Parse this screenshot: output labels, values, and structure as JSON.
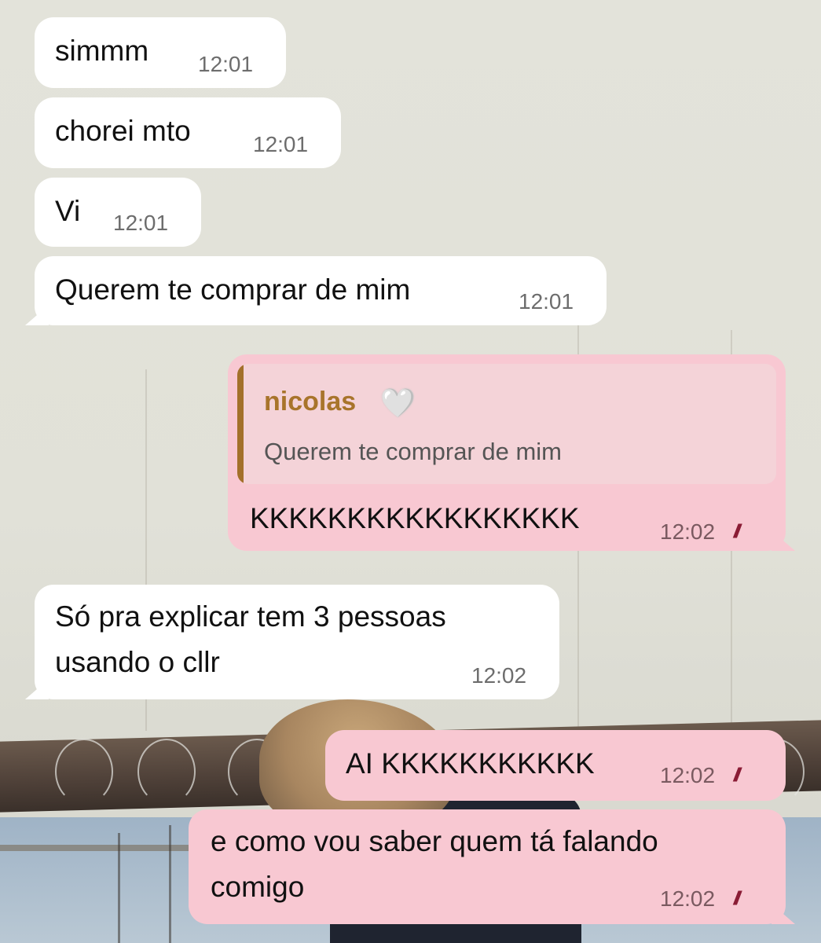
{
  "messages": [
    {
      "text": "simmm",
      "time": "12:01"
    },
    {
      "text": "chorei mto",
      "time": "12:01"
    },
    {
      "text": "Vi",
      "time": "12:01"
    },
    {
      "text": "Querem te comprar de mim",
      "time": "12:01"
    },
    {
      "text": "KKKKKKKKKKKKKKKKK",
      "time": "12:02",
      "reply_to": {
        "sender": "nicolas",
        "emoji": "🤍",
        "text": "Querem te comprar de mim"
      }
    },
    {
      "lines": [
        "Só pra explicar tem 3 pessoas",
        "usando o cllr"
      ],
      "time": "12:02"
    },
    {
      "text": "AI KKKKKKKKKKK",
      "time": "12:02"
    },
    {
      "lines": [
        "e como vou saber quem tá falando",
        "comigo"
      ],
      "time": "12:02"
    }
  ],
  "colors": {
    "incoming": "#ffffff",
    "outgoing": "#f8c8d2",
    "read_ticks": "#8a1c35",
    "reply_name": "#a8742b"
  },
  "icons": {
    "read_receipt": "double-check-icon"
  }
}
